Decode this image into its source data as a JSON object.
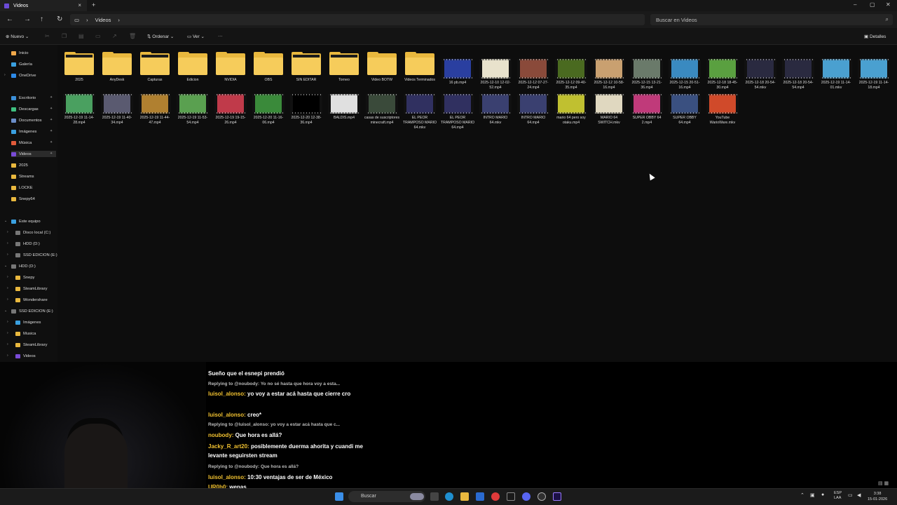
{
  "window": {
    "tab_title": "Videos",
    "tab_close": "×",
    "new_tab": "+",
    "min": "–",
    "max": "▢",
    "close": "✕"
  },
  "nav": {
    "back": "←",
    "forward": "→",
    "up": "↑",
    "refresh": "↻",
    "breadcrumb": [
      "▭",
      "›",
      "Videos",
      "›"
    ],
    "search_placeholder": "Buscar en Videos",
    "search_icon": "⌕"
  },
  "toolbar": {
    "new_label": "Nuevo",
    "sort_label": "Ordenar",
    "view_label": "Ver",
    "more_label": "···",
    "details_label": "Detalles"
  },
  "sidebar": {
    "quick": [
      {
        "label": "Inicio",
        "icon": "home-icon",
        "color": "#f0a84a"
      },
      {
        "label": "Galería",
        "icon": "gallery-icon",
        "color": "#3aa0e0"
      },
      {
        "label": "OneDrive",
        "icon": "cloud-icon",
        "color": "#2d8ae8"
      }
    ],
    "pinned": [
      {
        "label": "Escritorio",
        "color": "#3b8fd9"
      },
      {
        "label": "Descargas",
        "color": "#3fbf7f"
      },
      {
        "label": "Documentos",
        "color": "#6a8ec9"
      },
      {
        "label": "Imágenes",
        "color": "#3aa0e0"
      },
      {
        "label": "Música",
        "color": "#e05a3a"
      },
      {
        "label": "Videos",
        "color": "#7a4bd6"
      }
    ],
    "folders": [
      {
        "label": "2025"
      },
      {
        "label": "Streams"
      },
      {
        "label": "LOCKE"
      },
      {
        "label": "Snepy64"
      }
    ],
    "tree": [
      {
        "label": "Este equipo",
        "indent": 0,
        "color": "#3aa0e0"
      },
      {
        "label": "Disco local (C:)",
        "indent": 1,
        "color": "#777"
      },
      {
        "label": "HDD (D:)",
        "indent": 1,
        "color": "#777"
      },
      {
        "label": "SSD EDICION (E:)",
        "indent": 1,
        "color": "#777"
      },
      {
        "label": "HDD (D:)",
        "indent": 0,
        "color": "#777"
      },
      {
        "label": "Snepy",
        "indent": 1,
        "color": "#e9b83e"
      },
      {
        "label": "SteamLibrary",
        "indent": 1,
        "color": "#e9b83e"
      },
      {
        "label": "Wondershare",
        "indent": 1,
        "color": "#e9b83e"
      },
      {
        "label": "SSD EDICION (E:)",
        "indent": 0,
        "color": "#777"
      },
      {
        "label": "Imágenes",
        "indent": 1,
        "color": "#3aa0e0"
      },
      {
        "label": "Musica",
        "indent": 1,
        "color": "#e9b83e"
      },
      {
        "label": "SteamLibrary",
        "indent": 1,
        "color": "#e9b83e"
      },
      {
        "label": "Videos",
        "indent": 1,
        "color": "#7a4bd6"
      }
    ]
  },
  "items_row1": [
    {
      "label": "2025",
      "type": "folder",
      "doc": true
    },
    {
      "label": "AnyDesk",
      "type": "folder"
    },
    {
      "label": "Capturas",
      "type": "folder",
      "doc": true
    },
    {
      "label": "Edicion",
      "type": "folder"
    },
    {
      "label": "NVIDIA",
      "type": "folder"
    },
    {
      "label": "OBS",
      "type": "folder"
    },
    {
      "label": "SIN EDITAR",
      "type": "folder",
      "doc": true
    },
    {
      "label": "Torneo",
      "type": "folder",
      "doc": true
    },
    {
      "label": "Video BOTW",
      "type": "folder"
    },
    {
      "label": "Videos Terminados",
      "type": "folder"
    },
    {
      "label": "16 pb.mp4",
      "type": "video",
      "color": "#2a3fa0"
    },
    {
      "label": "2025-12-10 12-02-52.mp4",
      "type": "video",
      "color": "#e8e2cc"
    },
    {
      "label": "2025-12-12 07-27-24.mp4",
      "type": "video",
      "color": "#8a4a3a"
    },
    {
      "label": "2025-12-12 09-40-35.mp4",
      "type": "video",
      "color": "#4a6a20"
    },
    {
      "label": "2025-12-12 10-58-16.mp4",
      "type": "video",
      "color": "#c9a070"
    },
    {
      "label": "2025-12-15 13-21-36.mp4",
      "type": "video",
      "color": "#6a7a6a"
    },
    {
      "label": "2025-12-15 20-51-16.mp4",
      "type": "video",
      "color": "#3a8ac0"
    },
    {
      "label": "2025-12-18 18-45-30.mp4",
      "type": "video",
      "color": "#5aa040"
    },
    {
      "label": "2025-12-18 20-54-54.mkv",
      "type": "video",
      "color": "#2a2a40"
    },
    {
      "label": "2025-12-18 20-54-54.mp4",
      "type": "video",
      "color": "#2a2a40"
    },
    {
      "label": "2025-12-19 11-14-01.mkv",
      "type": "video",
      "color": "#4aa0d0"
    },
    {
      "label": "2025-12-19 11-14-18.mp4",
      "type": "video",
      "color": "#4aa0d0"
    }
  ],
  "items_row2": [
    {
      "label": "2025-12-19 11-14-28.mp4",
      "color": "#4aa060"
    },
    {
      "label": "2025-12-19 11-40-34.mp4",
      "color": "#5a5a70"
    },
    {
      "label": "2025-12-19 11-44-47.mp4",
      "color": "#b08030"
    },
    {
      "label": "2025-12-19 11-53-54.mp4",
      "color": "#5aa050"
    },
    {
      "label": "2025-12-19 19-15-26.mp4",
      "color": "#c03a4a"
    },
    {
      "label": "2025-12-20 11-16-06.mp4",
      "color": "#3a8a3a"
    },
    {
      "label": "2025-12-20 12-38-36.mp4",
      "color": "#000000"
    },
    {
      "label": "BALDIS.mp4",
      "color": "#e0e0e0"
    },
    {
      "label": "casas de suscriptores minecraft.mp4",
      "color": "#3a4a3a"
    },
    {
      "label": "EL PEOR TRAMPOSO MARIO 64.mkv",
      "color": "#303060"
    },
    {
      "label": "EL PEOR TRAMPOSO MARIO 64.mp4",
      "color": "#303060"
    },
    {
      "label": "INTRO MARIO 64.mkv",
      "color": "#3a4070"
    },
    {
      "label": "INTRO MARIO 64.mp4",
      "color": "#3a4070"
    },
    {
      "label": "mario 64 pero soy otaku.mp4",
      "color": "#c0c030"
    },
    {
      "label": "MARIO 64 SWITCH.mkv",
      "color": "#e0d8c0"
    },
    {
      "label": "SUPER OBBY 64 2.mp4",
      "color": "#c03a7a"
    },
    {
      "label": "SUPER OBBY 64.mp4",
      "color": "#3a5080"
    },
    {
      "label": "YouTube WarioWare.mkv",
      "color": "#d04a2a"
    }
  ],
  "chat": {
    "messages": [
      {
        "kind": "msg",
        "user": "",
        "text": "Sueño que el esnepi prendió"
      },
      {
        "kind": "reply",
        "text": "Replying to @noubody: Yo no sé hasta que hora voy a esta..."
      },
      {
        "kind": "msg",
        "user": "luisol_alonso:",
        "text": " yo voy a estar acá hasta que cierre cro"
      },
      {
        "kind": "msg",
        "user": "luisol_alonso:",
        "text": " creo*"
      },
      {
        "kind": "reply",
        "text": "Replying to @luisol_alonso: yo voy a estar acá hasta que c..."
      },
      {
        "kind": "msg",
        "user": "noubody:",
        "text": " Que hora es allá?"
      },
      {
        "kind": "msg",
        "user": "Jacky_R_art20:",
        "text": " posiblemente duerma ahorita y cuandi me levante seguirsten stream"
      },
      {
        "kind": "reply",
        "text": "Replying to @noubody: Que hora es allá?"
      },
      {
        "kind": "msg",
        "user": "luisol_alonso:",
        "text": " 10:30 ventajas de ser de México"
      },
      {
        "kind": "msg",
        "user": "UR0b0:",
        "text": " wenas"
      }
    ]
  },
  "taskbar": {
    "search_label": "Buscar",
    "lang_top": "ESP",
    "lang_bottom": "LAA",
    "time": "3:38",
    "date": "15-01-2026"
  }
}
